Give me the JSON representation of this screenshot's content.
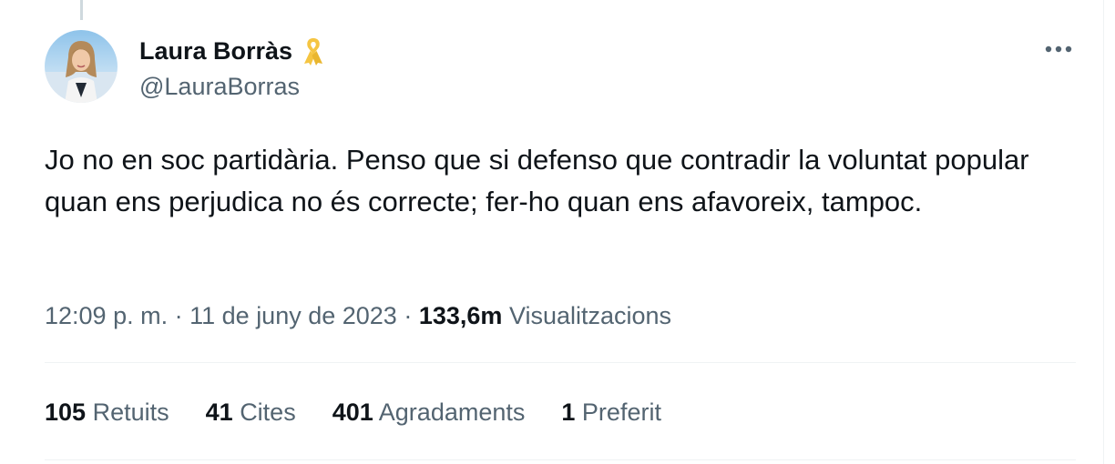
{
  "author": {
    "display_name": "Laura Borràs",
    "handle": "@LauraBorras",
    "badge_icon": "yellow-ribbon-icon",
    "badge_color": "#f5c542"
  },
  "tweet": {
    "text": "Jo no en soc partidària. Penso que si defenso que contradir la voluntat popular quan ens perjudica no és correcte; fer-ho quan ens afavoreix, tampoc.",
    "time": "12:09 p. m.",
    "separator": "·",
    "date": "11 de juny de 2023",
    "views_count": "133,6m",
    "views_label": "Visualitzacions"
  },
  "stats": {
    "retweets": {
      "count": "105",
      "label": "Retuits"
    },
    "quotes": {
      "count": "41",
      "label": "Cites"
    },
    "likes": {
      "count": "401",
      "label": "Agradaments"
    },
    "bookmarks": {
      "count": "1",
      "label": "Preferit"
    }
  },
  "icons": {
    "more": "more-dots-icon"
  },
  "colors": {
    "text_primary": "#0f1419",
    "text_secondary": "#536471",
    "divider": "#eff3f4"
  }
}
